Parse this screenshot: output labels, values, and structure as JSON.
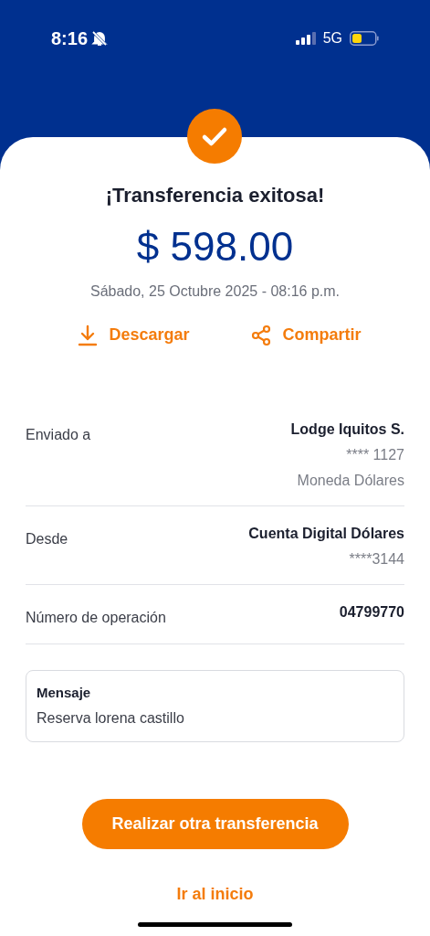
{
  "status_bar": {
    "time": "8:16",
    "network": "5G"
  },
  "receipt": {
    "title": "¡Transferencia exitosa!",
    "amount": "$ 598.00",
    "date": "Sábado, 25 Octubre 2025 - 08:16 p.m.",
    "actions": [
      {
        "kind": "download",
        "label": "Descargar"
      },
      {
        "kind": "share",
        "label": "Compartir"
      }
    ],
    "details": [
      {
        "label": "Enviado a",
        "values": [
          "Lodge Iquitos S.",
          "**** 1127",
          "Moneda Dólares"
        ]
      },
      {
        "label": "Desde",
        "values": [
          "Cuenta Digital Dólares",
          "****3144"
        ]
      },
      {
        "label": "Número de operación",
        "values": [
          "04799770"
        ]
      }
    ],
    "message": {
      "title": "Mensaje",
      "text": "Reserva lorena castillo"
    }
  },
  "buttons": {
    "primary": "Realizar otra transferencia",
    "secondary": "Ir al inicio"
  }
}
